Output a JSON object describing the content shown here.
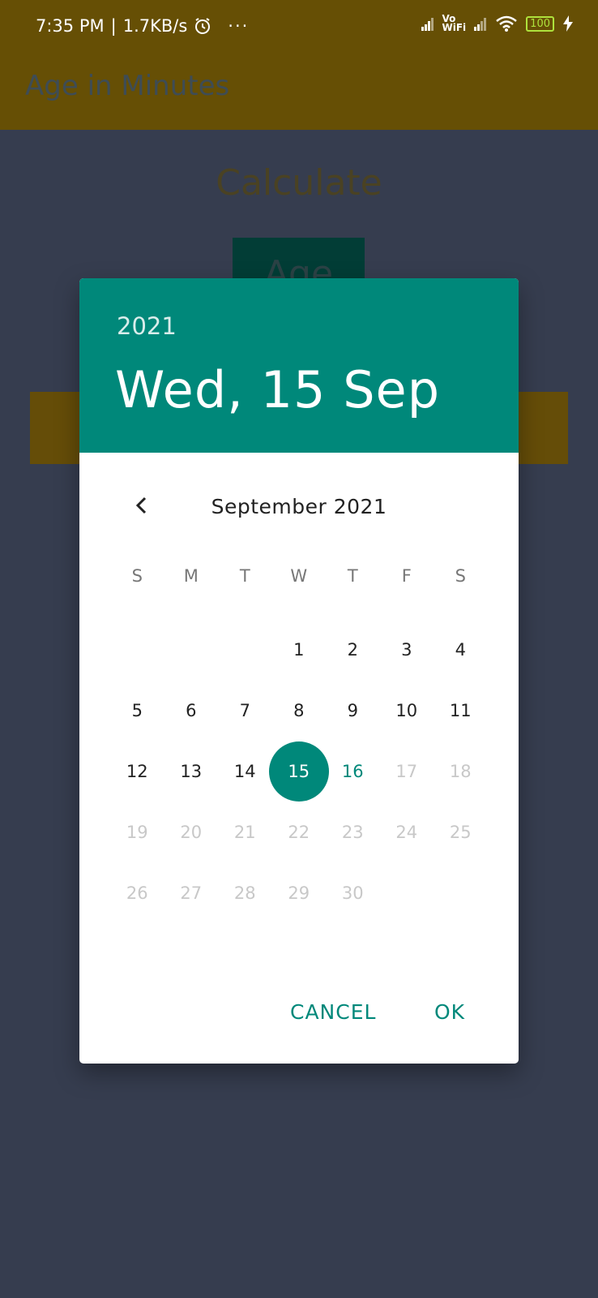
{
  "status_bar": {
    "time": "7:35 PM",
    "separator": "|",
    "speed": "1.7KB/s",
    "more": "···",
    "wifi_label_top": "Vo",
    "wifi_label_bottom": "WiFi",
    "battery": "100",
    "icons": [
      "alarm-icon",
      "signal-icon",
      "wifi-icon",
      "battery-icon",
      "charging-icon"
    ]
  },
  "app_bar": {
    "title": "Age in Minutes"
  },
  "background": {
    "calculate_label": "Calculate",
    "age_button_label": "Age"
  },
  "dialog": {
    "year": "2021",
    "selected_date": "Wed, 15 Sep",
    "month_label": "September 2021",
    "weekdays": [
      "S",
      "M",
      "T",
      "W",
      "T",
      "F",
      "S"
    ],
    "weeks": [
      [
        "",
        "",
        "",
        "1",
        "2",
        "3",
        "4"
      ],
      [
        "5",
        "6",
        "7",
        "8",
        "9",
        "10",
        "11"
      ],
      [
        "12",
        "13",
        "14",
        "15",
        "16",
        "17",
        "18"
      ],
      [
        "19",
        "20",
        "21",
        "22",
        "23",
        "24",
        "25"
      ],
      [
        "26",
        "27",
        "28",
        "29",
        "30",
        "",
        ""
      ]
    ],
    "selected_day": "15",
    "today_day": "16",
    "max_enabled_day": 16,
    "cancel_label": "CANCEL",
    "ok_label": "OK"
  },
  "colors": {
    "accent": "#00887a",
    "app_bar": "#664f05",
    "background": "#363d4f",
    "disabled_text": "#c8c8c8"
  }
}
